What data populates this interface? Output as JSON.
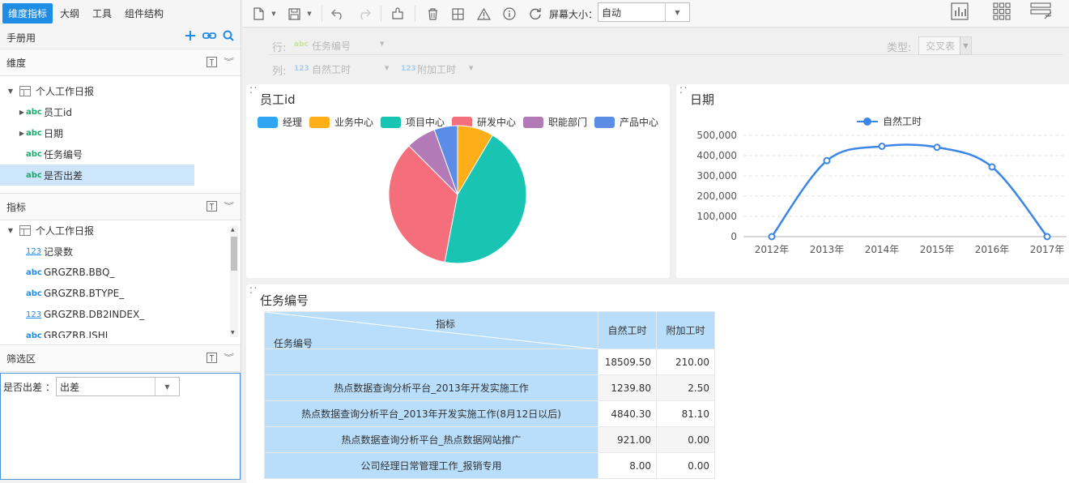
{
  "left_panel": {
    "tabs": [
      "维度指标",
      "大纲",
      "工具",
      "组件结构"
    ],
    "datasource": "手册用",
    "dimension_section": {
      "title": "维度"
    },
    "dimension_tree": {
      "root": "个人工作日报",
      "items": [
        {
          "type": "abc",
          "label": "员工id",
          "expandable": true
        },
        {
          "type": "abc",
          "label": "日期",
          "expandable": true
        },
        {
          "type": "abc",
          "label": "任务编号",
          "expandable": false
        },
        {
          "type": "abc",
          "label": "是否出差",
          "expandable": false,
          "selected": true
        }
      ]
    },
    "measure_section": {
      "title": "指标"
    },
    "measure_tree": {
      "root": "个人工作日报",
      "items": [
        {
          "type": "123",
          "label": "记录数"
        },
        {
          "type": "abc",
          "label": "GRGZRB.BBQ_"
        },
        {
          "type": "abc",
          "label": "GRGZRB.BTYPE_"
        },
        {
          "type": "123",
          "label": "GRGZRB.DB2INDEX_"
        },
        {
          "type": "abc",
          "label": "GRGZRB.ISHJ"
        }
      ]
    },
    "filter_section": {
      "title": "筛选区"
    },
    "filter": {
      "label": "是否出差 ：",
      "value": "出差"
    }
  },
  "toolbar": {
    "screen_size_label": "屏幕大小：",
    "screen_size_value": "自动"
  },
  "config": {
    "row_label": "行:",
    "row_type": "abc",
    "row_field": "任务编号",
    "col_label": "列:",
    "col_fields": [
      {
        "type": "123",
        "label": "自然工时"
      },
      {
        "type": "123",
        "label": "附加工时"
      }
    ],
    "type_label": "类型:",
    "type_value": "交叉表"
  },
  "pie_widget": {
    "title": "员工id",
    "chart_data": {
      "type": "pie",
      "title": "员工id",
      "slices": [
        {
          "name": "经理",
          "value": 0,
          "color": "#2ea6f2"
        },
        {
          "name": "业务中心",
          "value": 8.5,
          "color": "#fdae19"
        },
        {
          "name": "项目中心",
          "value": 44.5,
          "color": "#19c4b3"
        },
        {
          "name": "研发中心",
          "value": 34.5,
          "color": "#f56e7b"
        },
        {
          "name": "职能部门",
          "value": 7.0,
          "color": "#b37ab8"
        },
        {
          "name": "产品中心",
          "value": 5.5,
          "color": "#5b8ce6"
        }
      ]
    }
  },
  "line_widget": {
    "title": "日期",
    "chart_data": {
      "type": "line",
      "title": "日期",
      "x": [
        "2012年",
        "2013年",
        "2014年",
        "2015年",
        "2016年",
        "2017年"
      ],
      "series": [
        {
          "name": "自然工时",
          "values": [
            0,
            375000,
            446000,
            441000,
            344000,
            0
          ],
          "color": "#3b86e6"
        }
      ],
      "y_ticks": [
        "0",
        "100,000",
        "200,000",
        "300,000",
        "400,000",
        "500,000"
      ],
      "ylim": [
        0,
        500000
      ],
      "grid": true,
      "legend": "top-center"
    }
  },
  "table_widget": {
    "title": "任务编号",
    "corner_top": "指标",
    "corner_bottom": "任务编号",
    "columns": [
      "自然工时",
      "附加工时"
    ],
    "rows": [
      {
        "label": "",
        "values": [
          "18509.50",
          "210.00"
        ]
      },
      {
        "label": "热点数据查询分析平台_2013年开发实施工作",
        "values": [
          "1239.80",
          "2.50"
        ]
      },
      {
        "label": "热点数据查询分析平台_2013年开发实施工作(8月12日以后)",
        "values": [
          "4840.30",
          "81.10"
        ]
      },
      {
        "label": "热点数据查询分析平台_热点数据网站推广",
        "values": [
          "921.00",
          "0.00"
        ]
      },
      {
        "label": "公司经理日常管理工作_报销专用",
        "values": [
          "8.00",
          "0.00"
        ]
      }
    ]
  }
}
